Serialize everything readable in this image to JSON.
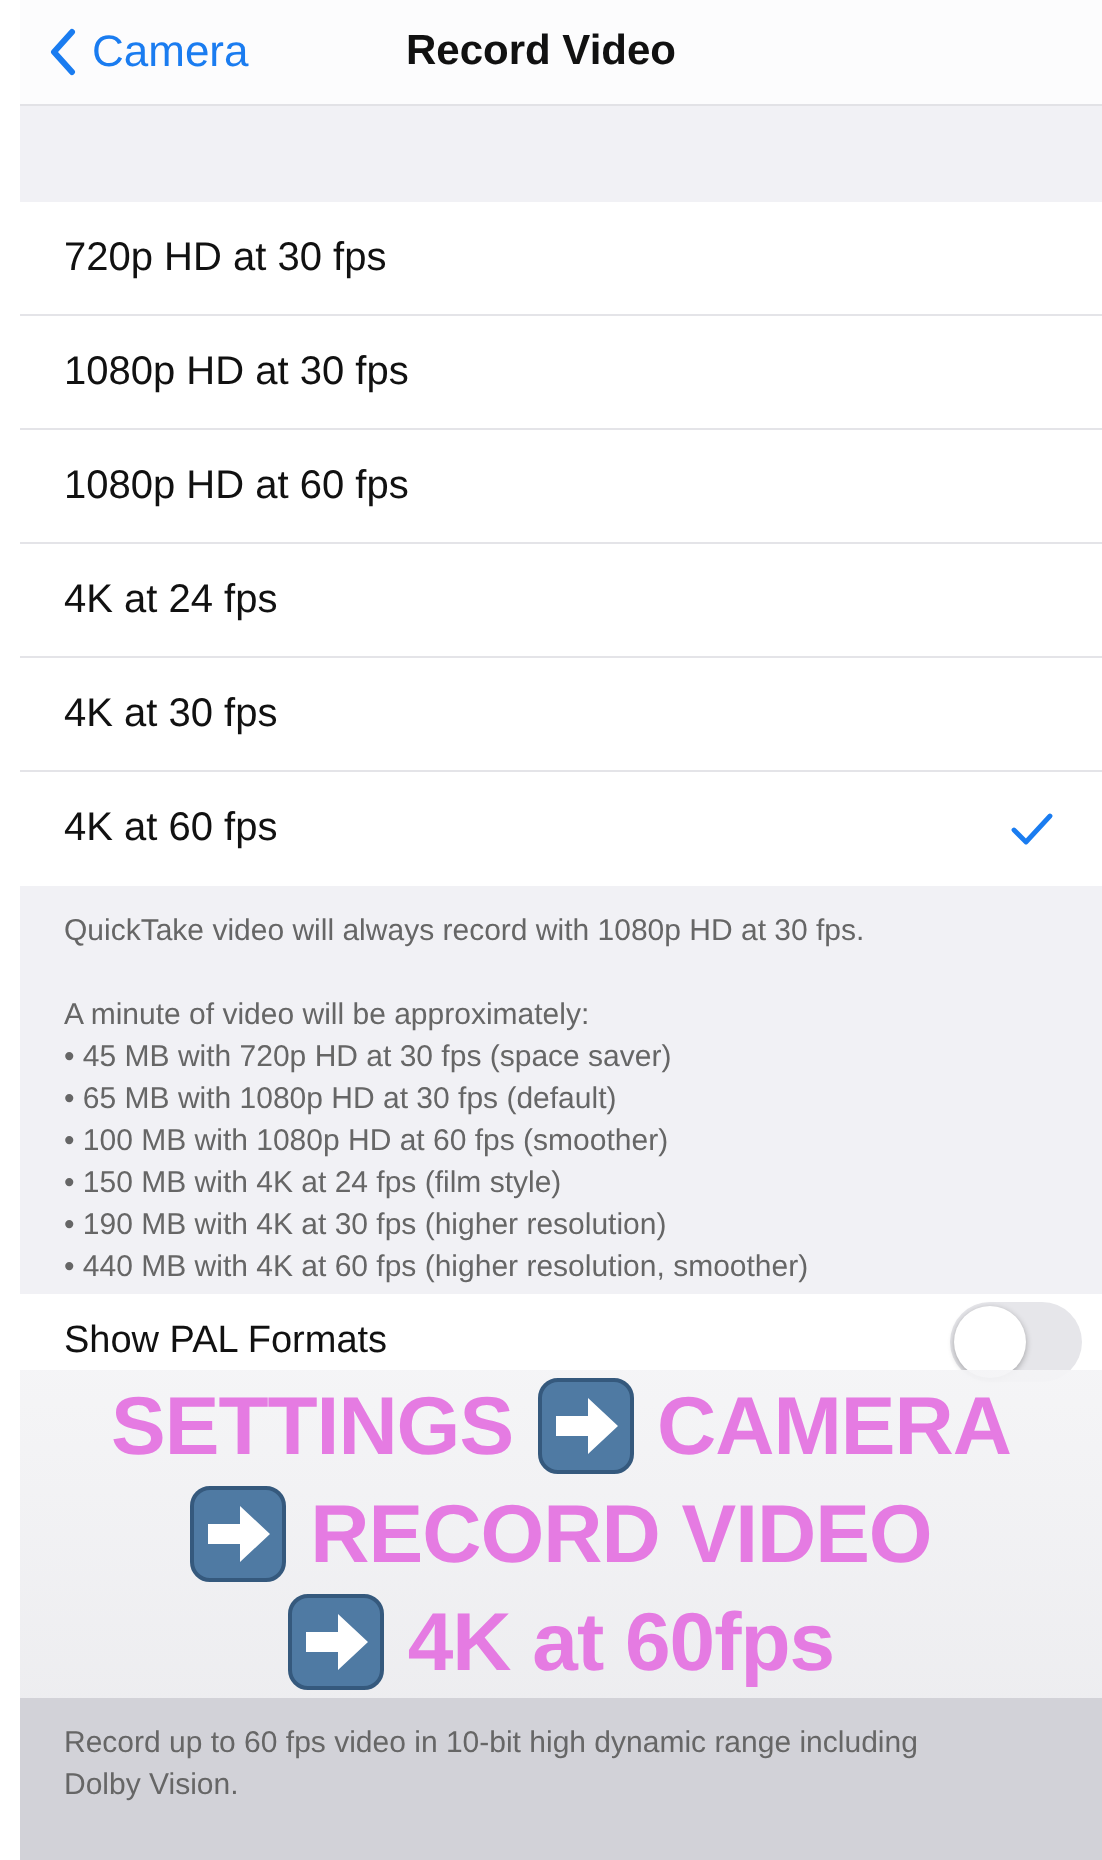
{
  "nav": {
    "back": "Camera",
    "title": "Record Video"
  },
  "options": [
    {
      "label": "720p HD at 30 fps",
      "selected": false
    },
    {
      "label": "1080p HD at 30 fps",
      "selected": false
    },
    {
      "label": "1080p HD at 60 fps",
      "selected": false
    },
    {
      "label": "4K at 24 fps",
      "selected": false
    },
    {
      "label": "4K at 30 fps",
      "selected": false
    },
    {
      "label": "4K at 60 fps",
      "selected": true
    }
  ],
  "options_footer": {
    "note": "QuickTake video will always record with 1080p HD at 30 fps.",
    "intro": "A minute of video will be approximately:",
    "sizes": [
      "• 45 MB with 720p HD at 30 fps (space saver)",
      "• 65 MB with 1080p HD at 30 fps (default)",
      "• 100 MB with 1080p HD at 60 fps (smoother)",
      "• 150 MB with 4K at 24 fps (film style)",
      "• 190 MB with 4K at 30 fps (higher resolution)",
      "• 440 MB with 4K at 60 fps (higher resolution, smoother)"
    ]
  },
  "pal_row": {
    "label": "Show PAL Formats",
    "on": false
  },
  "caption": [
    [
      {
        "kind": "text",
        "text": "SETTINGS"
      },
      {
        "kind": "arrow"
      },
      {
        "kind": "text",
        "text": "CAMERA"
      }
    ],
    [
      {
        "kind": "arrow"
      },
      {
        "kind": "text",
        "text": "RECORD VIDEO"
      }
    ],
    [
      {
        "kind": "arrow"
      },
      {
        "kind": "text",
        "text": "4K at 60fps"
      }
    ]
  ],
  "hdr_footer": "Record up to 60 fps video in 10-bit high dynamic range including Dolby Vision."
}
